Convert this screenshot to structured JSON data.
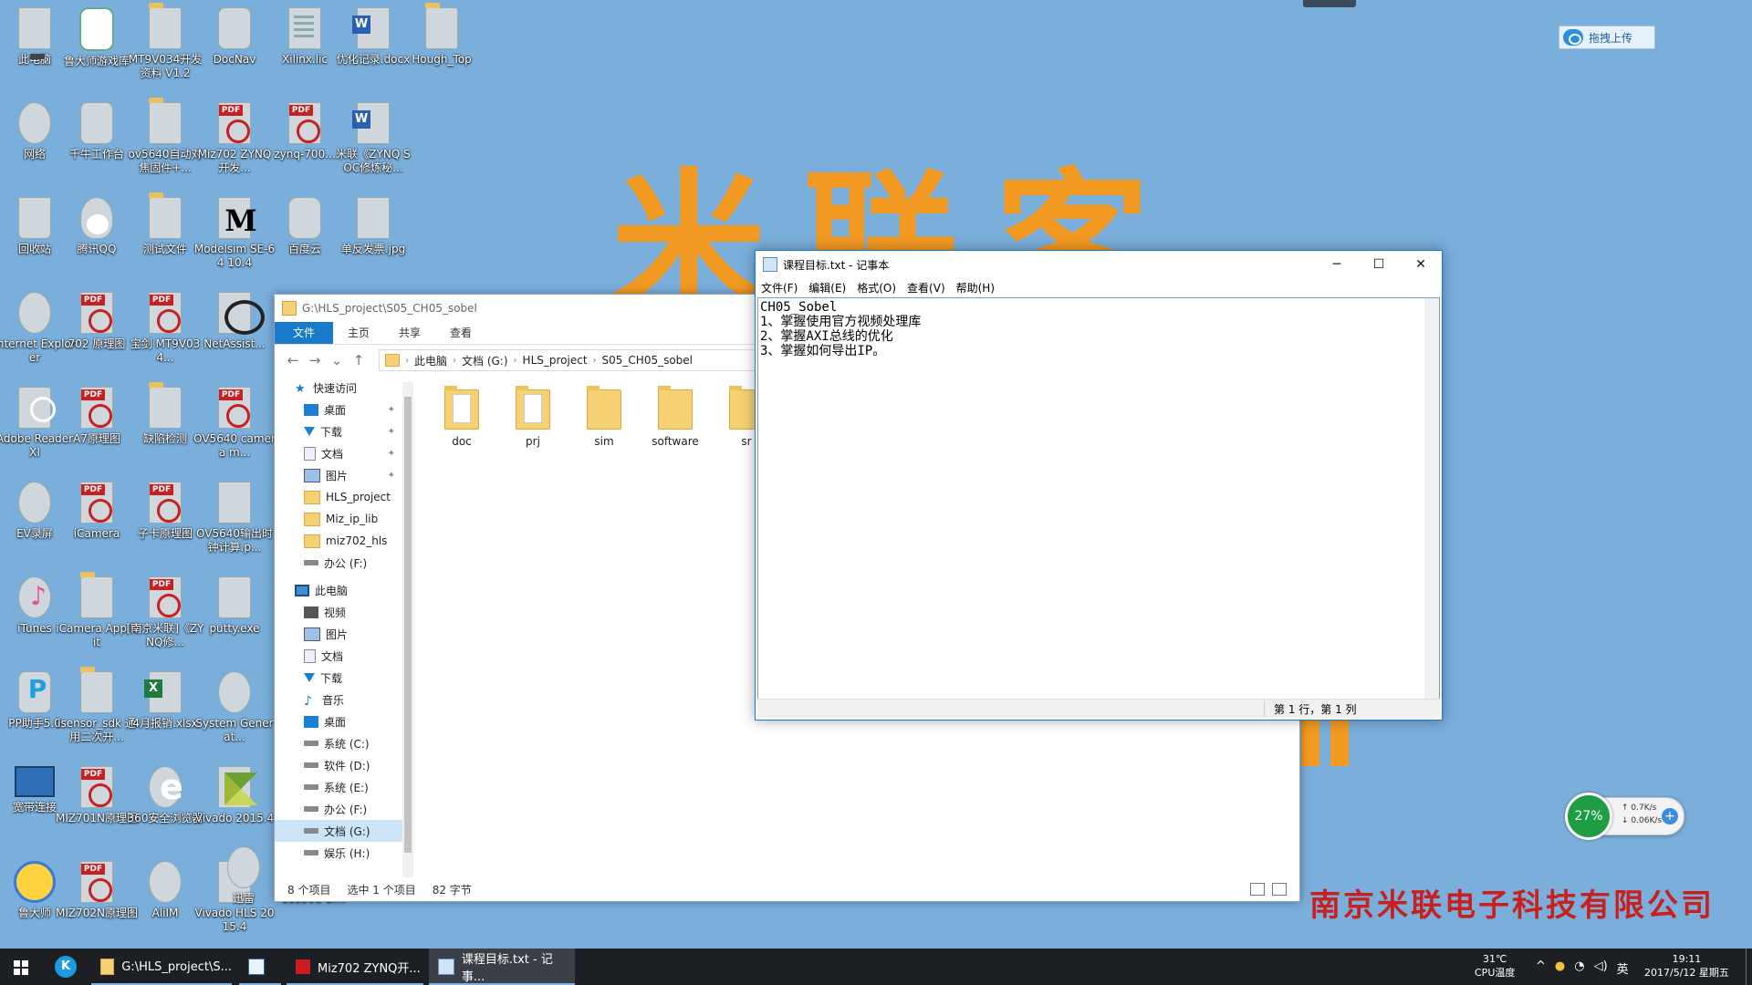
{
  "desktop": {
    "watermark": "米联客",
    "company": "南京米联电子科技有限公司",
    "upload_button": "拖拽上传",
    "icons": [
      {
        "label": "此电脑",
        "icon": "pc-icon"
      },
      {
        "label": "鲁大师游戏库",
        "icon": "gamebox-icon"
      },
      {
        "label": "MT9V034开发资料 V1.2",
        "icon": "folder-icon"
      },
      {
        "label": "DocNav",
        "icon": "docnav-icon"
      },
      {
        "label": "Xilinx.lic",
        "icon": "file-icon"
      },
      {
        "label": "优化记录.docx",
        "icon": "word-icon"
      },
      {
        "label": "Hough_Top",
        "icon": "folder-icon"
      },
      {
        "label": "网络",
        "icon": "network-icon"
      },
      {
        "label": "千牛工作台",
        "icon": "qianniu-icon"
      },
      {
        "label": "ov5640自动对焦固件+...",
        "icon": "folder-icon"
      },
      {
        "label": "Miz702 ZYNQ开发...",
        "icon": "pdf-icon"
      },
      {
        "label": "zynq-700...",
        "icon": "pdf-icon"
      },
      {
        "label": "米联《ZYNQ SOC修炼秘...",
        "icon": "word-icon"
      },
      {
        "label": "回收站",
        "icon": "recycle-bin-icon"
      },
      {
        "label": "腾讯QQ",
        "icon": "qq-icon"
      },
      {
        "label": "测试文件",
        "icon": "folder-icon"
      },
      {
        "label": "Modelsim SE-64 10.4",
        "icon": "modelsim-icon"
      },
      {
        "label": "百度云",
        "icon": "baidu-cloud-icon"
      },
      {
        "label": "单反发票.jpg",
        "icon": "image-icon"
      },
      {
        "label": "Internet Explorer",
        "icon": "ie-icon"
      },
      {
        "label": "702 原理图",
        "icon": "pdf-icon"
      },
      {
        "label": "宝剑 MT9V034...",
        "icon": "pdf-icon"
      },
      {
        "label": "NetAssist...",
        "icon": "netassist-icon"
      },
      {
        "label": "Adobe Reader XI",
        "icon": "adobe-icon"
      },
      {
        "label": "A7原理图",
        "icon": "pdf-icon"
      },
      {
        "label": "缺陷检测",
        "icon": "folder-icon"
      },
      {
        "label": "OV5640 camera m...",
        "icon": "pdf-icon"
      },
      {
        "label": "EV录屏",
        "icon": "ev-icon"
      },
      {
        "label": "iCamera",
        "icon": "pdf-icon"
      },
      {
        "label": "子卡原理图",
        "icon": "pdf-icon"
      },
      {
        "label": "OV5640输出时钟计算.p...",
        "icon": "image-icon"
      },
      {
        "label": "iTunes",
        "icon": "itunes-icon"
      },
      {
        "label": "iCamera App Kit",
        "icon": "folder-icon"
      },
      {
        "label": "[南京米联]《ZYNQ修...",
        "icon": "pdf-icon"
      },
      {
        "label": "putty.exe",
        "icon": "putty-icon"
      },
      {
        "label": "PP助手5.0",
        "icon": "pp-icon"
      },
      {
        "label": "isensor_sdk 通用二次开...",
        "icon": "folder-icon"
      },
      {
        "label": "4月报销.xlsx",
        "icon": "excel-icon"
      },
      {
        "label": "System Generat...",
        "icon": "sysgen-icon"
      },
      {
        "label": "宽带连接",
        "icon": "remote-icon"
      },
      {
        "label": "MIZ701N原理图",
        "icon": "pdf-icon"
      },
      {
        "label": "360安全浏览器",
        "icon": "browser360-icon"
      },
      {
        "label": "Vivado 2015.4",
        "icon": "vivado-icon"
      },
      {
        "label": "鲁大师",
        "icon": "ludashi-icon"
      },
      {
        "label": "MIZ702N原理图",
        "icon": "pdf-icon"
      },
      {
        "label": "AliIM",
        "icon": "aliim-icon"
      },
      {
        "label": "Vivado HLS 2015.4",
        "icon": "vivado-hls-icon"
      },
      {
        "label": "迅雷",
        "icon": "xunlei-icon"
      },
      {
        "label": "eos80d-bi...",
        "icon": "image-icon"
      }
    ]
  },
  "explorer": {
    "title": "G:\\HLS_project\\S05_CH05_sobel",
    "ribbon_tabs": [
      "文件",
      "主页",
      "共享",
      "查看"
    ],
    "breadcrumb": [
      "此电脑",
      "文档 (G:)",
      "HLS_project",
      "S05_CH05_sobel"
    ],
    "sidebar": [
      {
        "label": "快速访问",
        "icon": "star"
      },
      {
        "label": "桌面",
        "icon": "blue"
      },
      {
        "label": "下载",
        "icon": "dl"
      },
      {
        "label": "文档",
        "icon": "doc"
      },
      {
        "label": "图片",
        "icon": "pic"
      },
      {
        "label": "HLS_project",
        "icon": "folder"
      },
      {
        "label": "Miz_ip_lib",
        "icon": "folder"
      },
      {
        "label": "miz702_hls",
        "icon": "folder"
      },
      {
        "label": "办公 (F:)",
        "icon": "drive"
      },
      {
        "label": "此电脑",
        "icon": "pc"
      },
      {
        "label": "视频",
        "icon": "video"
      },
      {
        "label": "图片",
        "icon": "pic"
      },
      {
        "label": "文档",
        "icon": "doc"
      },
      {
        "label": "下载",
        "icon": "dl"
      },
      {
        "label": "音乐",
        "icon": "music"
      },
      {
        "label": "桌面",
        "icon": "blue"
      },
      {
        "label": "系统 (C:)",
        "icon": "drive"
      },
      {
        "label": "软件 (D:)",
        "icon": "drive"
      },
      {
        "label": "系统 (E:)",
        "icon": "drive"
      },
      {
        "label": "办公 (F:)",
        "icon": "drive"
      },
      {
        "label": "文档 (G:)",
        "icon": "drive"
      },
      {
        "label": "娱乐 (H:)",
        "icon": "drive"
      }
    ],
    "files": [
      "doc",
      "prj",
      "sim",
      "software",
      "sr"
    ],
    "status": {
      "count": "8 个项目",
      "selected": "选中 1 个项目",
      "size": "82 字节"
    }
  },
  "notepad": {
    "title": "课程目标.txt - 记事本",
    "menu": [
      "文件(F)",
      "编辑(E)",
      "格式(O)",
      "查看(V)",
      "帮助(H)"
    ],
    "content": "CH05_Sobel\n1、掌握使用官方视频处理库\n2、掌握AXI总线的优化\n3、掌握如何导出IP。",
    "status_position": "第 1 行，第 1 列"
  },
  "net_widget": {
    "percent": "27%",
    "up": "0.7K/s",
    "down": "0.06K/s"
  },
  "taskbar": {
    "tasks": [
      {
        "label": "G:\\HLS_project\\S...",
        "icon": "folder-icon"
      },
      {
        "label": "",
        "icon": "app-icon"
      },
      {
        "label": "Miz702 ZYNQ开...",
        "icon": "pdf-icon"
      },
      {
        "label": "课程目标.txt - 记事...",
        "icon": "notepad-icon"
      }
    ],
    "temp": "31℃",
    "temp_label": "CPU温度",
    "ime": "英",
    "time": "19:11",
    "date": "2017/5/12 星期五"
  },
  "colors": {
    "desktop": "#7aaedb",
    "accent": "#1979ca",
    "watermark": "#f39a23",
    "company": "#c8201f"
  }
}
